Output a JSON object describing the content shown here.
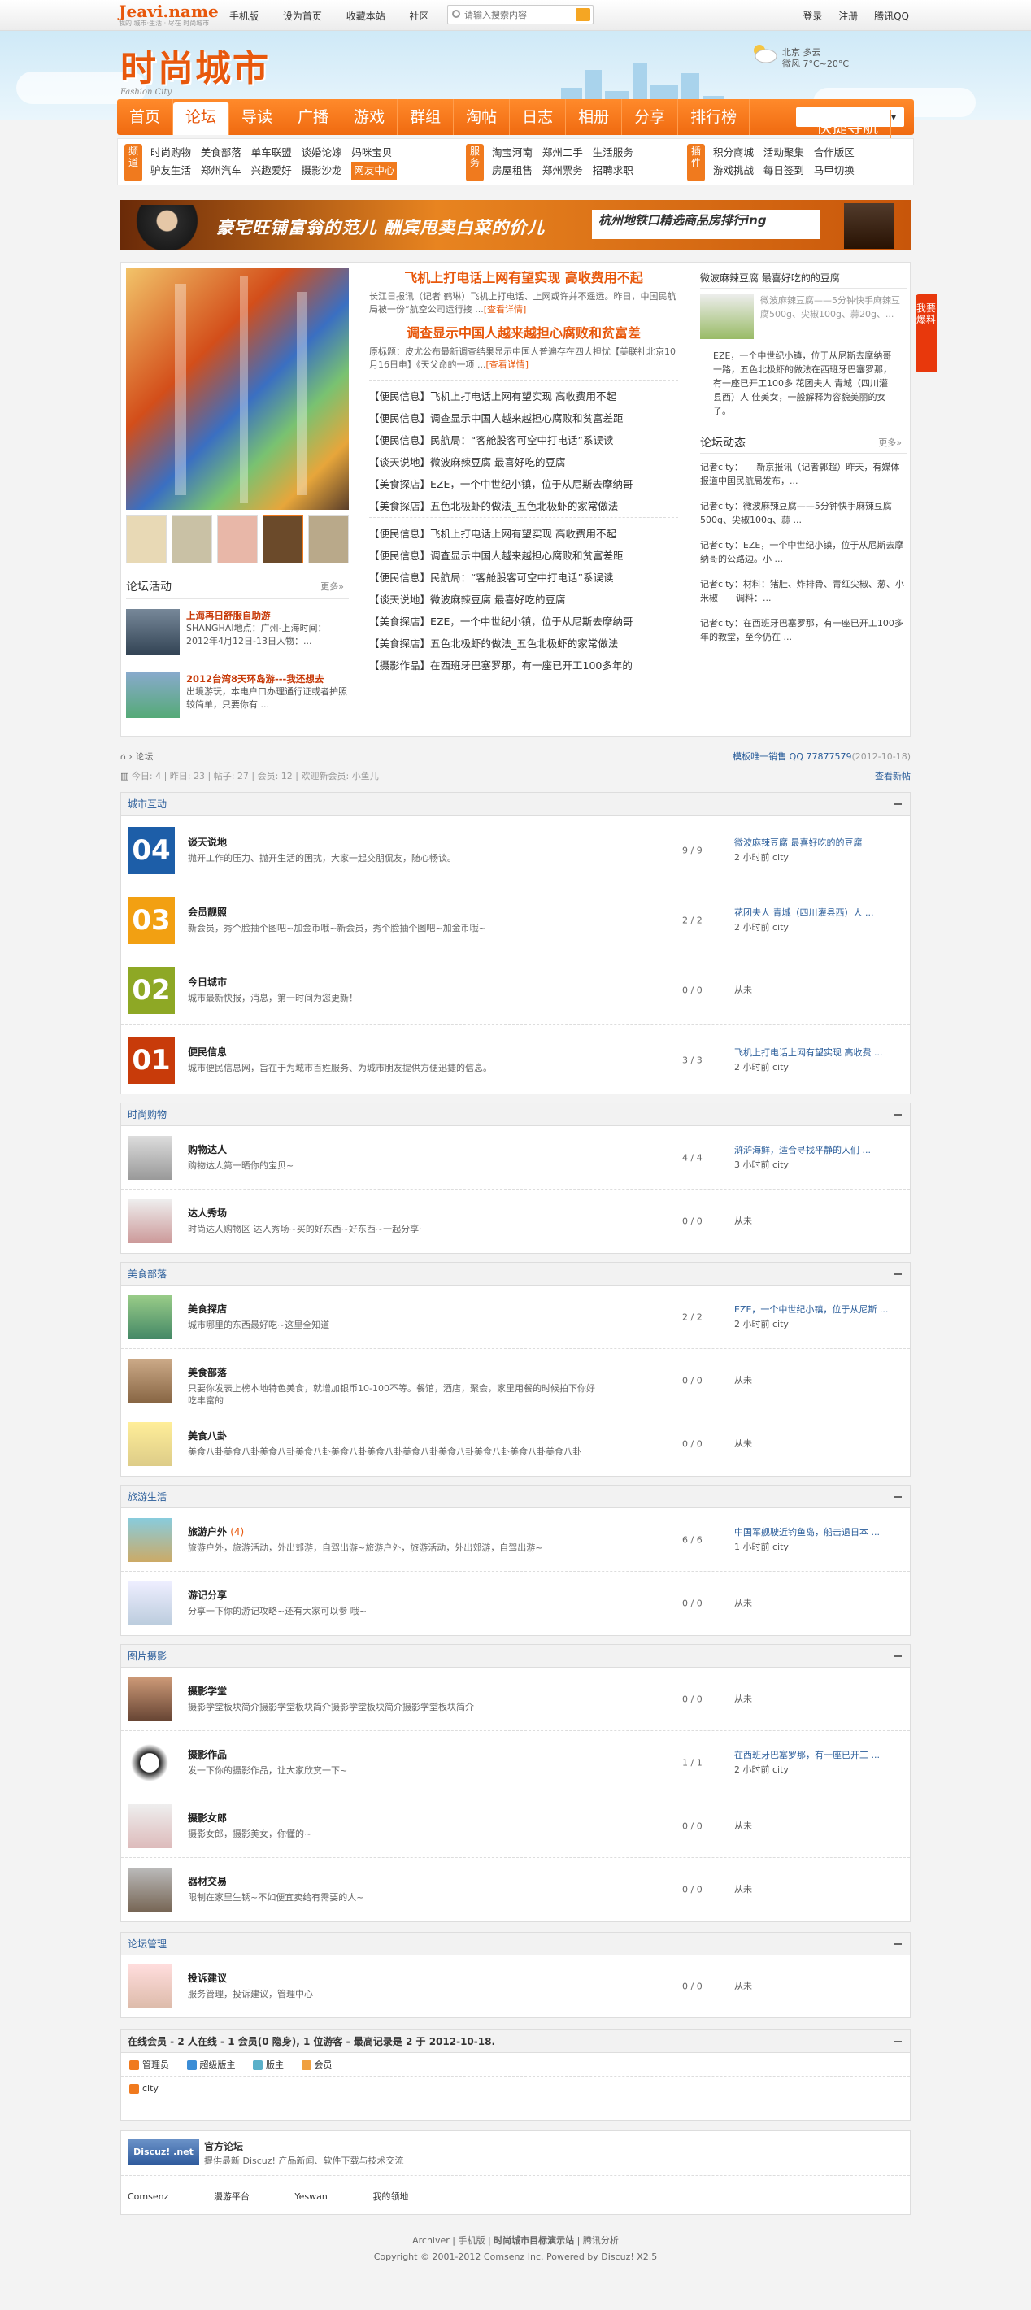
{
  "topbar": {
    "logo_main": "Jeavi.name",
    "logo_sub": "我的 城市·生活 · 尽在 时尚城市",
    "links": [
      "手机版",
      "设为首页",
      "收藏本站",
      "社区"
    ],
    "search_placeholder": "请输入搜索内容",
    "right_links": [
      "登录",
      "注册",
      "腾讯QQ"
    ]
  },
  "header": {
    "logo": "时尚城市",
    "logo_sub": "Fashion City",
    "weather_line1": "北京 多云",
    "weather_line2": "微风 7°C~20°C"
  },
  "nav": {
    "items": [
      "首页",
      "论坛",
      "导读",
      "广播",
      "游戏",
      "群组",
      "淘帖",
      "日志",
      "相册",
      "分享",
      "排行榜"
    ],
    "active_index": 1,
    "quick_nav": "快捷导航"
  },
  "subnav": {
    "groups": [
      {
        "tag": "频道",
        "items": [
          "时尚购物",
          "美食部落",
          "单车联盟",
          "谈婚论嫁",
          "妈咪宝贝",
          "驴友生活",
          "郑州汽车",
          "兴趣爱好",
          "摄影沙龙",
          "网友中心"
        ],
        "highlight": 9
      },
      {
        "tag": "服务",
        "items": [
          "淘宝河南",
          "郑州二手",
          "生活服务",
          "房屋租售",
          "郑州票务",
          "招聘求职"
        ],
        "highlight": -1
      },
      {
        "tag": "插件",
        "items": [
          "积分商城",
          "活动聚集",
          "合作版区",
          "游戏挑战",
          "每日签到",
          "马甲切换"
        ],
        "highlight": -1
      }
    ]
  },
  "banner": {
    "text1": "豪宅旺铺富翁的范儿 酬宾甩卖白菜的价儿",
    "text2": "杭州地铁口精选商品房排行ing"
  },
  "portal": {
    "forum_activity_title": "论坛活动",
    "more": "更多»",
    "activities": [
      {
        "title": "上海再日舒服自助游",
        "desc": "SHANGHAI地点：广州-上海时间：2012年4月12日-13日人物：..."
      },
      {
        "title": "2012台湾8天环岛游---我还想去",
        "desc": "出境游玩，本电户口办理通行证或者护照较简单，只要你有 ..."
      }
    ],
    "headline1": "飞机上打电话上网有望实现 高收费用不起",
    "summary1": "长江日报讯（记者 鹤琳）飞机上打电话、上网或许并不遥远。昨日，中国民航局被一份“航空公司运行接 ...",
    "headline2": "调查显示中国人越来越担心腐败和贫富差",
    "summary2": "原标题：皮尤公布最新调查结果显示中国人普遍存在四大担忧【美联社北京10月16日电】《天父命的一项 ...",
    "read_more": "[查看详情]",
    "list1": [
      "【便民信息】飞机上打电话上网有望实现 高收费用不起",
      "【便民信息】调查显示中国人越来越担心腐败和贫富差距",
      "【便民信息】民航局：“客舱股客可空中打电话”系误读",
      "【谈天说地】微波麻辣豆腐 最喜好吃的豆腐",
      "【美食探店】EZE，一个中世纪小镇，位于从尼斯去摩纳哥",
      "【美食探店】五色北极虾的做法_五色北极虾的家常做法"
    ],
    "list2": [
      "【便民信息】飞机上打电话上网有望实现 高收费用不起",
      "【便民信息】调查显示中国人越来越担心腐败和贫富差距",
      "【便民信息】民航局：“客舱股客可空中打电话”系误读",
      "【谈天说地】微波麻辣豆腐 最喜好吃的豆腐",
      "【美食探店】EZE，一个中世纪小镇，位于从尼斯去摩纳哥",
      "【美食探店】五色北极虾的做法_五色北极虾的家常做法",
      "【摄影作品】在西班牙巴塞罗那，有一座已开工100多年的"
    ],
    "right_title": "微波麻辣豆腐 最喜好吃的的豆腐",
    "right_snippet": "微波麻辣豆腐——5分钟快手麻辣豆腐500g、尖椒100g、蒜20g、...",
    "right_text": "EZE，一个中世纪小镇，位于从尼斯去摩纳哥一路，五色北极虾的做法在西班牙巴塞罗那，有一座已开工100多 花团夫人 青城（四川灌县西）人 佳美女，一般解释为容貌美丽的女子。",
    "dynamic_title": "论坛动态",
    "dynamic": [
      "记者city：　　新京报讯（记者郭超）昨天，有媒体报道中国民航局发布，...",
      "记者city：微波麻辣豆腐——5分钟快手麻辣豆腐500g、尖椒100g、蒜 ...",
      "记者city：EZE，一个中世纪小镇，位于从尼斯去摩纳哥的公路边。小 ...",
      "记者city：材料：猪肚、炸排骨、青红尖椒、葱、小米椒　　调料：...",
      "记者city：在西班牙巴塞罗那，有一座已开工100多年的教堂，至今仍在 ..."
    ],
    "side_button": "我要爆料"
  },
  "breadcrumb": {
    "forum": "论坛",
    "right": "模板唯一销售 QQ 77877579",
    "right_date": "(2012-10-18)"
  },
  "stats": {
    "text": "今日: 4 | 昨日: 23 | 帖子: 27 | 会员: 12 | 欢迎新会员: 小鱼儿",
    "new_posts": "查看新帖"
  },
  "forums": [
    {
      "title": "城市互动",
      "rows": [
        {
          "num": "04",
          "color": "#1d5ea8",
          "name": "谈天说地",
          "desc": "抛开工作的压力、抛开生活的困扰，大家一起交朋侃友，随心畅谈。",
          "count": "9 / 9",
          "last": "微波麻辣豆腐 最喜好吃的的豆腐",
          "time": "2 小时前 city"
        },
        {
          "num": "03",
          "color": "#f2a012",
          "name": "会员靓照",
          "desc": "新会员，秀个脸抽个图吧~加金币哦~新会员，秀个脸抽个图吧~加金币哦~",
          "count": "2 / 2",
          "last": "花团夫人 青城（四川灌县西）人 ...",
          "time": "2 小时前 city"
        },
        {
          "num": "02",
          "color": "#8ea825",
          "name": "今日城市",
          "desc": "城市最新快报，消息，第一时间为您更新！",
          "count": "0 / 0",
          "last": "",
          "time": "从未"
        },
        {
          "num": "01",
          "color": "#c83b0a",
          "name": "便民信息",
          "desc": "城市便民信息网，旨在于为城市百姓服务、为城市朋友提供方便迅捷的信息。",
          "count": "3 / 3",
          "last": "飞机上打电话上网有望实现 高收费 ...",
          "time": "2 小时前 city"
        }
      ]
    },
    {
      "title": "时尚购物",
      "rows": [
        {
          "name": "购物达人",
          "desc": "购物达人第一晒你的宝贝~",
          "count": "4 / 4",
          "last": "浒浒海鲜，适合寻找平静的人们 ...",
          "time": "3 小时前 city"
        },
        {
          "name": "达人秀场",
          "desc": "时尚达人购物区 达人秀场~买的好东西~好东西~一起分享·",
          "count": "0 / 0",
          "last": "",
          "time": "从未"
        }
      ]
    },
    {
      "title": "美食部落",
      "rows": [
        {
          "name": "美食探店",
          "desc": "城市哪里的东西最好吃~这里全知道",
          "count": "2 / 2",
          "last": "EZE，一个中世纪小镇，位于从尼斯 ...",
          "time": "2 小时前 city"
        },
        {
          "name": "美食部落",
          "desc": "只要你发表上榜本地特色美食，就增加银币10-100不等。餐馆，酒店，聚会，家里用餐的时候拍下你好吃丰富的",
          "count": "0 / 0",
          "last": "",
          "time": "从未"
        },
        {
          "name": "美食八卦",
          "desc": "美食八卦美食八卦美食八卦美食八卦美食八卦美食八卦美食八卦美食八卦美食八卦美食八卦美食八卦",
          "count": "0 / 0",
          "last": "",
          "time": "从未"
        }
      ]
    },
    {
      "title": "旅游生活",
      "rows": [
        {
          "name": "旅游户外",
          "badge": "(4)",
          "desc": "旅游户外，旅游活动，外出郊游，自驾出游~旅游户外，旅游活动，外出郊游，自驾出游~",
          "count": "6 / 6",
          "last": "中国军舰驶近钓鱼岛，船击退日本 ...",
          "time": "1 小时前 city"
        },
        {
          "name": "游记分享",
          "desc": "分享一下你的游记攻略~还有大家可以参 哦~",
          "count": "0 / 0",
          "last": "",
          "time": "从未"
        }
      ]
    },
    {
      "title": "图片摄影",
      "rows": [
        {
          "name": "摄影学堂",
          "desc": "摄影学堂板块简介摄影学堂板块简介摄影学堂板块简介摄影学堂板块简介",
          "count": "0 / 0",
          "last": "",
          "time": "从未"
        },
        {
          "name": "摄影作品",
          "desc": "发一下你的摄影作品，让大家欣赏一下~",
          "count": "1 / 1",
          "last": "在西班牙巴塞罗那，有一座已开工 ...",
          "time": "2 小时前 city"
        },
        {
          "name": "摄影女郎",
          "desc": "摄影女郎，摄影美女，你懂的~",
          "count": "0 / 0",
          "last": "",
          "time": "从未"
        },
        {
          "name": "器材交易",
          "desc": "限制在家里生锈~不如便宜卖给有需要的人~",
          "count": "0 / 0",
          "last": "",
          "time": "从未"
        }
      ]
    },
    {
      "title": "论坛管理",
      "rows": [
        {
          "name": "投诉建议",
          "desc": "服务管理，投诉建议，管理中心",
          "count": "0 / 0",
          "last": "",
          "time": "从未"
        }
      ]
    }
  ],
  "online": {
    "title": "在线会员 - 2 人在线 - 1 会员(0 隐身), 1 位游客 - 最高记录是 2 于 2012-10-18.",
    "legend": [
      "管理员",
      "超级版主",
      "版主",
      "会员"
    ],
    "members": [
      "city"
    ]
  },
  "links": {
    "title": "官方论坛",
    "desc": "提供最新 Discuz! 产品新闻、软件下载与技术交流",
    "logo": "Discuz! .net",
    "items": [
      "Comsenz",
      "漫游平台",
      "Yeswan",
      "我的领地"
    ]
  },
  "footer": {
    "links": [
      "Archiver",
      "手机版",
      "时尚城市目标演示站",
      "腾讯分析"
    ],
    "copyright": "Copyright © 2001-2012 Comsenz Inc.  Powered by Discuz! X2.5"
  },
  "colors": {
    "accent": "#f07a1e",
    "brand": "#e8580c",
    "link": "#2a5d9a"
  }
}
